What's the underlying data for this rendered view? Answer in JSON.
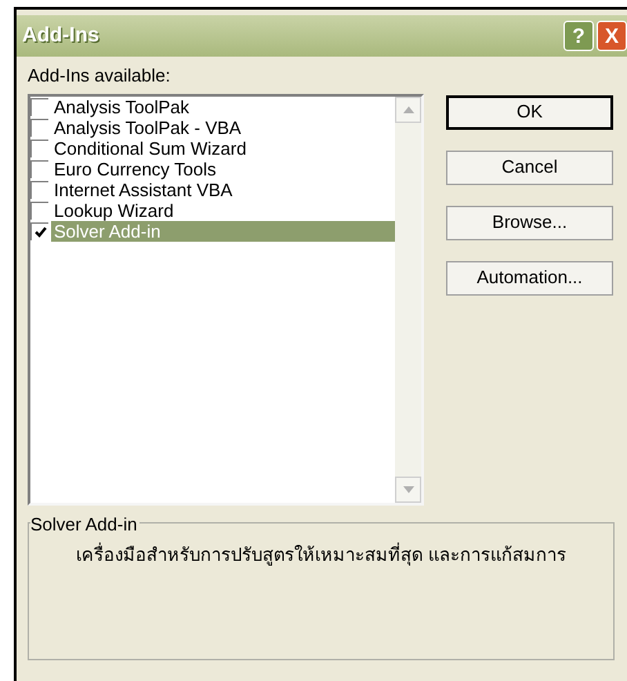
{
  "window": {
    "title": "Add-Ins",
    "title_buttons": [
      {
        "kind": "help",
        "label": "?"
      },
      {
        "kind": "close",
        "label": "X"
      }
    ]
  },
  "list_label": "Add-Ins available:",
  "addins": [
    {
      "label": "Analysis ToolPak",
      "checked": false,
      "selected": false
    },
    {
      "label": "Analysis ToolPak - VBA",
      "checked": false,
      "selected": false
    },
    {
      "label": "Conditional Sum Wizard",
      "checked": false,
      "selected": false
    },
    {
      "label": "Euro Currency Tools",
      "checked": false,
      "selected": false
    },
    {
      "label": "Internet Assistant VBA",
      "checked": false,
      "selected": false
    },
    {
      "label": "Lookup Wizard",
      "checked": false,
      "selected": false
    },
    {
      "label": "Solver Add-in",
      "checked": true,
      "selected": true
    }
  ],
  "buttons": [
    {
      "label": "OK",
      "default": true
    },
    {
      "label": "Cancel",
      "default": false
    },
    {
      "label": "Browse...",
      "default": false
    },
    {
      "label": "Automation...",
      "default": false
    }
  ],
  "description": {
    "title": "Solver Add-in",
    "text": "เครื่องมือสำหรับการปรับสูตรให้เหมาะสมที่สุด และการแก้สมการ"
  }
}
